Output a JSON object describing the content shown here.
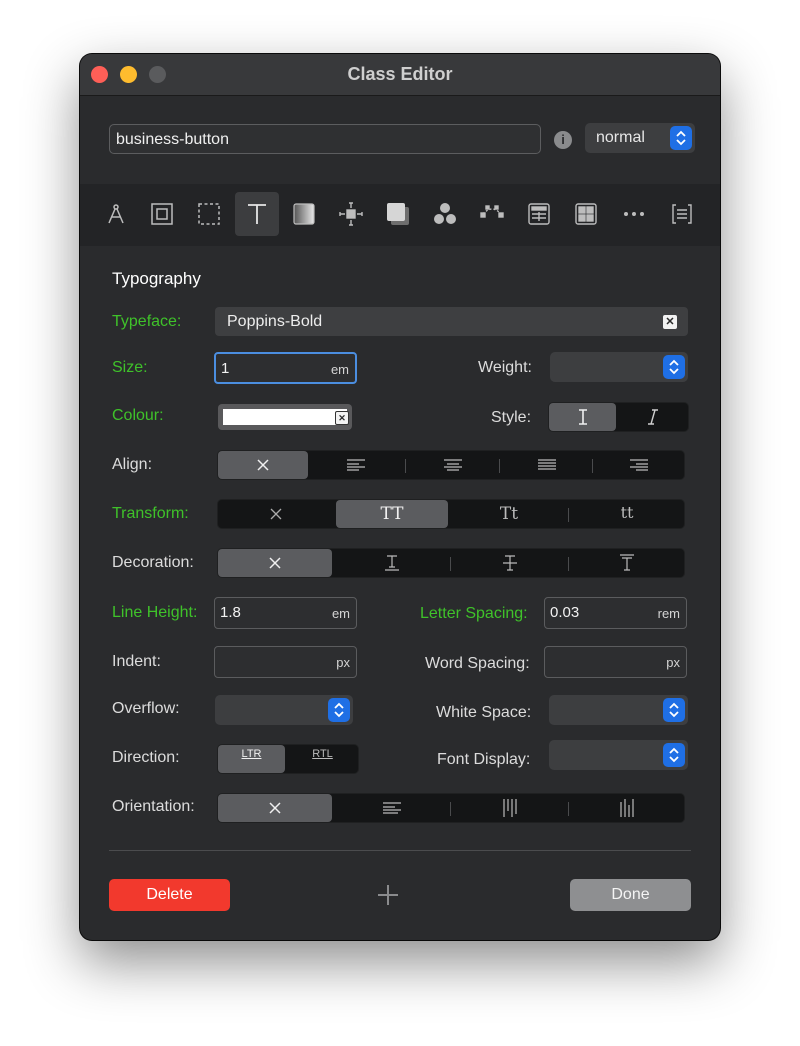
{
  "window": {
    "title": "Class Editor"
  },
  "header": {
    "class_name": "business-button",
    "state_select": "normal"
  },
  "toolbar": {
    "icons": [
      "compass-icon",
      "box-model-icon",
      "border-icon",
      "typography-icon",
      "background-icon",
      "spacing-icon",
      "shadow-icon",
      "effects-icon",
      "transform-icon",
      "table-icon",
      "grid-icon",
      "more-icon",
      "code-icon"
    ],
    "active": "typography-icon"
  },
  "typography": {
    "title": "Typography",
    "typeface": {
      "label": "Typeface:",
      "value": "Poppins-Bold"
    },
    "size": {
      "label": "Size:",
      "value": "1",
      "unit": "em"
    },
    "weight": {
      "label": "Weight:",
      "value": ""
    },
    "colour": {
      "label": "Colour:",
      "value": "#ffffff"
    },
    "style": {
      "label": "Style:",
      "options": [
        "normal",
        "italic"
      ],
      "selected": "normal"
    },
    "align": {
      "label": "Align:",
      "options": [
        "none",
        "left",
        "center",
        "justify",
        "right"
      ],
      "selected": "none"
    },
    "transform": {
      "label": "Transform:",
      "options": [
        "none",
        "TT",
        "Tt",
        "tt"
      ],
      "selected": "TT"
    },
    "decoration": {
      "label": "Decoration:",
      "options": [
        "none",
        "underline",
        "line-through",
        "overline"
      ],
      "selected": "none"
    },
    "line_height": {
      "label": "Line Height:",
      "value": "1.8",
      "unit": "em"
    },
    "letter_spacing": {
      "label": "Letter Spacing:",
      "value": "0.03",
      "unit": "rem"
    },
    "indent": {
      "label": "Indent:",
      "value": "",
      "unit": "px"
    },
    "word_spacing": {
      "label": "Word Spacing:",
      "value": "",
      "unit": "px"
    },
    "overflow": {
      "label": "Overflow:",
      "value": ""
    },
    "white_space": {
      "label": "White Space:",
      "value": ""
    },
    "direction": {
      "label": "Direction:",
      "options": [
        "LTR",
        "RTL"
      ],
      "selected": "LTR"
    },
    "font_display": {
      "label": "Font Display:",
      "value": ""
    },
    "orientation": {
      "label": "Orientation:",
      "options": [
        "none",
        "horizontal",
        "vertical-rl",
        "vertical-lr"
      ],
      "selected": "none"
    }
  },
  "footer": {
    "delete_label": "Delete",
    "done_label": "Done"
  },
  "colors": {
    "green_label": "#3fc22a",
    "accent_blue": "#1f6fe5",
    "delete_red": "#f2392d"
  }
}
